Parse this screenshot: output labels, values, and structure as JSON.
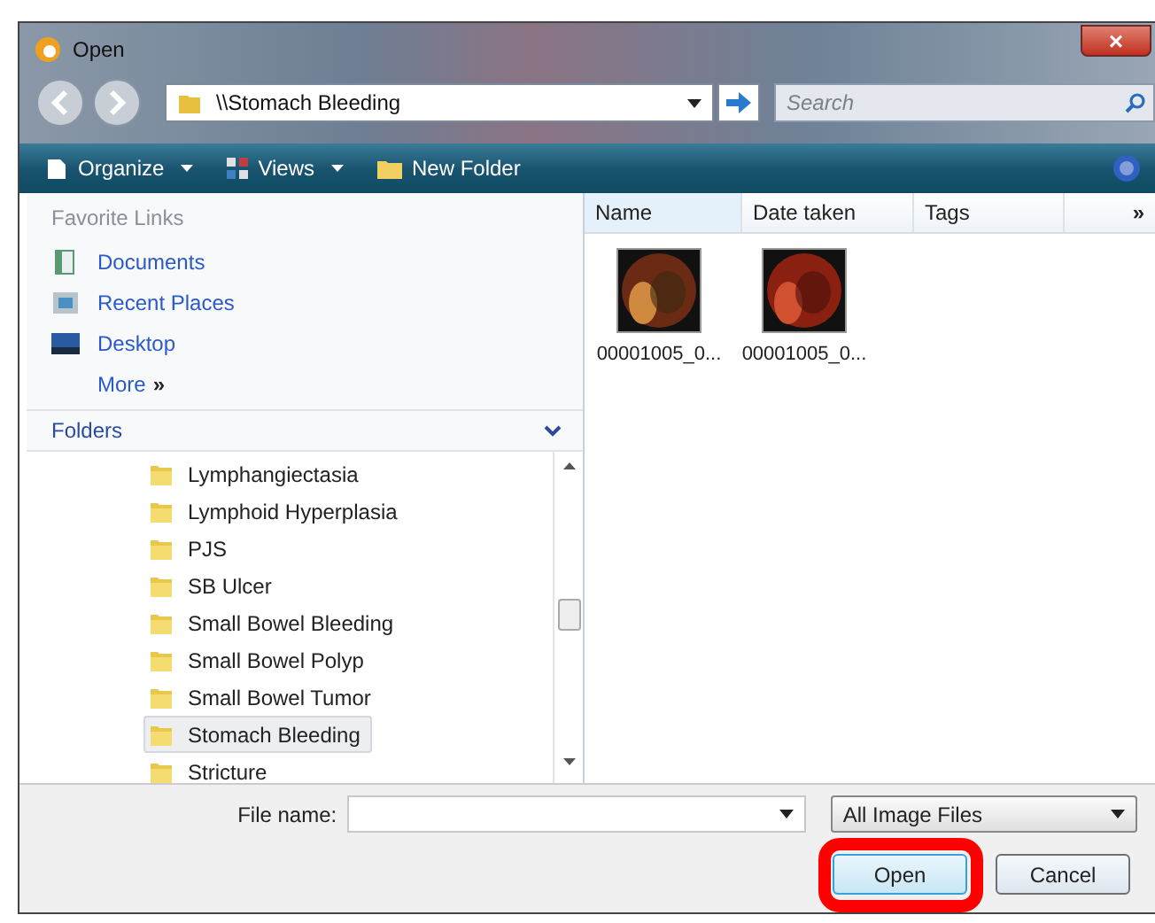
{
  "window": {
    "title": "Open",
    "close": "×"
  },
  "address": {
    "path": "\\\\Stomach Bleeding"
  },
  "search": {
    "placeholder": "Search"
  },
  "toolbar": [
    {
      "label": "Organize",
      "kind": "organize"
    },
    {
      "label": "Views",
      "kind": "views"
    },
    {
      "label": "New Folder",
      "kind": "newfolder"
    }
  ],
  "favorites": {
    "title": "Favorite Links",
    "items": [
      {
        "label": "Documents",
        "kind": "documents"
      },
      {
        "label": "Recent Places",
        "kind": "recent"
      },
      {
        "label": "Desktop",
        "kind": "desktop"
      }
    ],
    "more": "More",
    "more_mark": "»"
  },
  "folders": {
    "title": "Folders",
    "items": [
      {
        "label": "Lymphangiectasia",
        "selected": false
      },
      {
        "label": "Lymphoid Hyperplasia",
        "selected": false
      },
      {
        "label": "PJS",
        "selected": false
      },
      {
        "label": "SB Ulcer",
        "selected": false
      },
      {
        "label": "Small Bowel Bleeding",
        "selected": false
      },
      {
        "label": "Small Bowel Polyp",
        "selected": false
      },
      {
        "label": "Small Bowel Tumor",
        "selected": false
      },
      {
        "label": "Stomach Bleeding",
        "selected": true
      },
      {
        "label": "Stricture",
        "selected": false
      }
    ]
  },
  "columns": [
    "Name",
    "Date taken",
    "Tags"
  ],
  "columns_more": "»",
  "files": [
    {
      "name": "00001005_0...",
      "kind": "picture"
    },
    {
      "name": "00001005_0...",
      "kind": "picture"
    }
  ],
  "file_name": {
    "label": "File name:"
  },
  "file_type": {
    "value": "All Image Files"
  },
  "buttons": [
    {
      "label": "Open",
      "highlighted": true
    },
    {
      "label": "Cancel",
      "highlighted": false
    }
  ]
}
